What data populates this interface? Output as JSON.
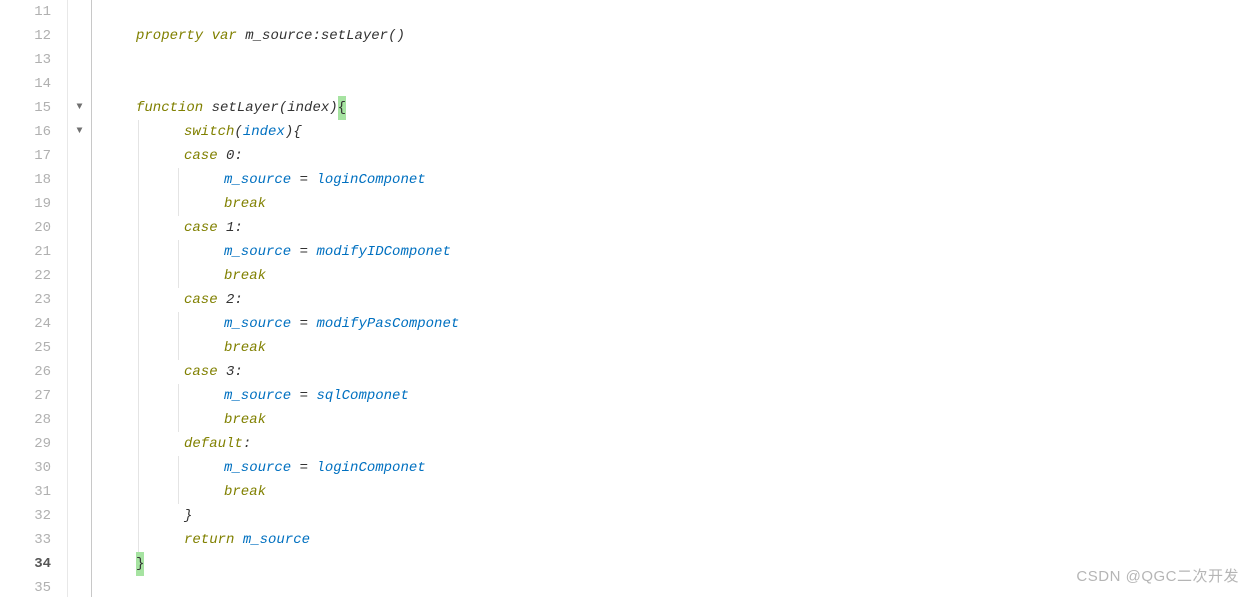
{
  "gutter": {
    "start": 11,
    "end": 35,
    "fold_lines": [
      15,
      16
    ],
    "current_line": 34
  },
  "watermark": "CSDN @QGC二次开发",
  "code": {
    "lines": [
      {
        "n": 11,
        "indent": 0,
        "tokens": []
      },
      {
        "n": 12,
        "indent": 0,
        "tokens": [
          {
            "t": "property",
            "c": "kw"
          },
          {
            "t": " ",
            "c": "sp"
          },
          {
            "t": "var",
            "c": "kw"
          },
          {
            "t": " ",
            "c": "sp"
          },
          {
            "t": "m_source",
            "c": "ident"
          },
          {
            "t": ":",
            "c": "punc"
          },
          {
            "t": "setLayer",
            "c": "func"
          },
          {
            "t": "()",
            "c": "punc"
          }
        ]
      },
      {
        "n": 13,
        "indent": 0,
        "tokens": []
      },
      {
        "n": 14,
        "indent": 0,
        "tokens": []
      },
      {
        "n": 15,
        "indent": 0,
        "tokens": [
          {
            "t": "function",
            "c": "kw"
          },
          {
            "t": " ",
            "c": "sp"
          },
          {
            "t": "setLayer",
            "c": "func"
          },
          {
            "t": "(",
            "c": "punc"
          },
          {
            "t": "index",
            "c": "ident"
          },
          {
            "t": ")",
            "c": "punc"
          },
          {
            "t": "{",
            "c": "hl"
          }
        ]
      },
      {
        "n": 16,
        "indent": 1,
        "guides": [
          0
        ],
        "tokens": [
          {
            "t": "switch",
            "c": "kw"
          },
          {
            "t": "(",
            "c": "punc"
          },
          {
            "t": "index",
            "c": "param"
          },
          {
            "t": "){",
            "c": "punc"
          }
        ]
      },
      {
        "n": 17,
        "indent": 1,
        "guides": [
          0
        ],
        "tokens": [
          {
            "t": "case",
            "c": "kw"
          },
          {
            "t": " ",
            "c": "sp"
          },
          {
            "t": "0",
            "c": "num"
          },
          {
            "t": ":",
            "c": "punc"
          }
        ]
      },
      {
        "n": 18,
        "indent": 2,
        "guides": [
          0,
          1
        ],
        "tokens": [
          {
            "t": "m_source",
            "c": "param"
          },
          {
            "t": " = ",
            "c": "punc"
          },
          {
            "t": "loginComponet",
            "c": "param"
          }
        ]
      },
      {
        "n": 19,
        "indent": 2,
        "guides": [
          0,
          1
        ],
        "tokens": [
          {
            "t": "break",
            "c": "kw"
          }
        ]
      },
      {
        "n": 20,
        "indent": 1,
        "guides": [
          0
        ],
        "tokens": [
          {
            "t": "case",
            "c": "kw"
          },
          {
            "t": " ",
            "c": "sp"
          },
          {
            "t": "1",
            "c": "num"
          },
          {
            "t": ":",
            "c": "punc"
          }
        ]
      },
      {
        "n": 21,
        "indent": 2,
        "guides": [
          0,
          1
        ],
        "tokens": [
          {
            "t": "m_source",
            "c": "param"
          },
          {
            "t": " = ",
            "c": "punc"
          },
          {
            "t": "modifyIDComponet",
            "c": "param"
          }
        ]
      },
      {
        "n": 22,
        "indent": 2,
        "guides": [
          0,
          1
        ],
        "tokens": [
          {
            "t": "break",
            "c": "kw"
          }
        ]
      },
      {
        "n": 23,
        "indent": 1,
        "guides": [
          0
        ],
        "tokens": [
          {
            "t": "case",
            "c": "kw"
          },
          {
            "t": " ",
            "c": "sp"
          },
          {
            "t": "2",
            "c": "num"
          },
          {
            "t": ":",
            "c": "punc"
          }
        ]
      },
      {
        "n": 24,
        "indent": 2,
        "guides": [
          0,
          1
        ],
        "tokens": [
          {
            "t": "m_source",
            "c": "param"
          },
          {
            "t": " = ",
            "c": "punc"
          },
          {
            "t": "modifyPasComponet",
            "c": "param"
          }
        ]
      },
      {
        "n": 25,
        "indent": 2,
        "guides": [
          0,
          1
        ],
        "tokens": [
          {
            "t": "break",
            "c": "kw"
          }
        ]
      },
      {
        "n": 26,
        "indent": 1,
        "guides": [
          0
        ],
        "tokens": [
          {
            "t": "case",
            "c": "kw"
          },
          {
            "t": " ",
            "c": "sp"
          },
          {
            "t": "3",
            "c": "num"
          },
          {
            "t": ":",
            "c": "punc"
          }
        ]
      },
      {
        "n": 27,
        "indent": 2,
        "guides": [
          0,
          1
        ],
        "tokens": [
          {
            "t": "m_source",
            "c": "param"
          },
          {
            "t": " = ",
            "c": "punc"
          },
          {
            "t": "sqlComponet",
            "c": "param"
          }
        ]
      },
      {
        "n": 28,
        "indent": 2,
        "guides": [
          0,
          1
        ],
        "tokens": [
          {
            "t": "break",
            "c": "kw"
          }
        ]
      },
      {
        "n": 29,
        "indent": 1,
        "guides": [
          0
        ],
        "tokens": [
          {
            "t": "default",
            "c": "kw"
          },
          {
            "t": ":",
            "c": "punc"
          }
        ]
      },
      {
        "n": 30,
        "indent": 2,
        "guides": [
          0,
          1
        ],
        "tokens": [
          {
            "t": "m_source",
            "c": "param"
          },
          {
            "t": " = ",
            "c": "punc"
          },
          {
            "t": "loginComponet",
            "c": "param"
          }
        ]
      },
      {
        "n": 31,
        "indent": 2,
        "guides": [
          0,
          1
        ],
        "tokens": [
          {
            "t": "break",
            "c": "kw"
          }
        ]
      },
      {
        "n": 32,
        "indent": 1,
        "guides": [
          0
        ],
        "tokens": [
          {
            "t": "}",
            "c": "punc"
          }
        ]
      },
      {
        "n": 33,
        "indent": 1,
        "guides": [
          0
        ],
        "tokens": [
          {
            "t": "return",
            "c": "kw"
          },
          {
            "t": " ",
            "c": "sp"
          },
          {
            "t": "m_source",
            "c": "param"
          }
        ]
      },
      {
        "n": 34,
        "indent": 0,
        "tokens": [
          {
            "t": "}",
            "c": "hl"
          }
        ]
      },
      {
        "n": 35,
        "indent": 0,
        "tokens": []
      }
    ]
  }
}
